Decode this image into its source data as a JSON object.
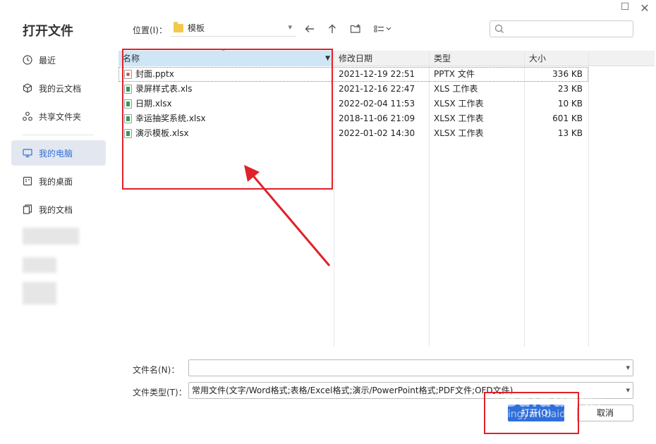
{
  "dialog": {
    "title": "打开文件"
  },
  "window_controls": {
    "maximize_icon": "maximize-icon",
    "close_icon": "close-icon"
  },
  "sidebar": {
    "items": [
      {
        "label": "最近",
        "icon": "clock-icon"
      },
      {
        "label": "我的云文档",
        "icon": "cloud-box-icon"
      },
      {
        "label": "共享文件夹",
        "icon": "share-icon"
      },
      {
        "label": "我的电脑",
        "icon": "monitor-icon",
        "active": true
      },
      {
        "label": "我的桌面",
        "icon": "desktop-icon"
      },
      {
        "label": "我的文档",
        "icon": "documents-icon"
      }
    ]
  },
  "toolbar": {
    "location_label": "位置(I)：",
    "location_value": "模板",
    "icons": [
      "back-arrow-icon",
      "up-arrow-icon",
      "new-folder-icon",
      "view-mode-icon",
      "search-icon"
    ]
  },
  "file_list": {
    "columns": [
      "名称",
      "修改日期",
      "类型",
      "大小"
    ],
    "rows": [
      {
        "name": "封面.pptx",
        "date": "2021-12-19 22:51",
        "type": "PPTX 文件",
        "size": "336 KB",
        "icon": "ppt"
      },
      {
        "name": "录屏样式表.xls",
        "date": "2021-12-16 22:47",
        "type": "XLS 工作表",
        "size": "23 KB",
        "icon": "xls"
      },
      {
        "name": "日期.xlsx",
        "date": "2022-02-04 11:53",
        "type": "XLSX 工作表",
        "size": "10 KB",
        "icon": "xls"
      },
      {
        "name": "幸运抽奖系统.xlsx",
        "date": "2018-11-06 21:09",
        "type": "XLSX 工作表",
        "size": "601 KB",
        "icon": "xls"
      },
      {
        "name": "演示模板.xlsx",
        "date": "2022-01-02 14:30",
        "type": "XLSX 工作表",
        "size": "13 KB",
        "icon": "xls"
      }
    ]
  },
  "form": {
    "filename_label": "文件名(N)：",
    "filename_value": "",
    "filetype_label": "文件类型(T)：",
    "filetype_value": "常用文件(文字/Word格式;表格/Excel格式;演示/PowerPoint格式;PDF文件;OFD文件)"
  },
  "buttons": {
    "open": "打开(O)",
    "cancel": "取消"
  },
  "annotation": {
    "color": "#e0212a"
  },
  "watermark": {
    "line1": "Baidu经验",
    "line2": "jingyan.baidu.com"
  },
  "colors": {
    "accent": "#2f6fdc",
    "header_selected": "#cfe6f7",
    "sidebar_active": "#e3e8f0"
  }
}
